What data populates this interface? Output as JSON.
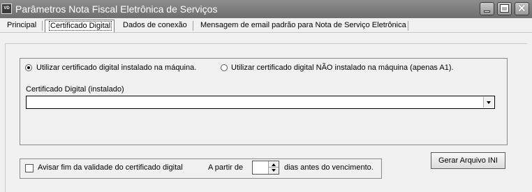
{
  "window": {
    "title": "Parâmetros Nota Fiscal Eletrônica de Serviços",
    "icon_text": "VD",
    "buttons": [
      "minimize-icon",
      "maximize-icon",
      "close-icon"
    ],
    "close_glyph": "✕"
  },
  "tabs": [
    {
      "label": "Principal",
      "active": false
    },
    {
      "label": "Certificado Digital",
      "active": true
    },
    {
      "label": "Dados de conexão",
      "active": false
    },
    {
      "label": "Mensagem de email padrão para Nota de Serviço Eletrônica",
      "active": false
    }
  ],
  "certificate": {
    "radio_installed_label": "Utilizar certificado digital instalado na máquina.",
    "radio_installed_checked": true,
    "radio_not_installed_label": "Utilizar certificado digital NÃO instalado na máquina (apenas A1).",
    "radio_not_installed_checked": false,
    "field_label": "Certificado Digital (instalado)",
    "field_value": ""
  },
  "validity": {
    "checkbox_label": "Avisar fim da validade do certificado digital",
    "checked": false,
    "from_label": "A partir de",
    "days_value": "",
    "days_suffix": "dias antes do vencimento."
  },
  "actions": {
    "generate_ini_label": "Gerar Arquivo INI"
  },
  "colors": {
    "titlebar": "#7a7a7a",
    "background": "#f0f0f0"
  }
}
